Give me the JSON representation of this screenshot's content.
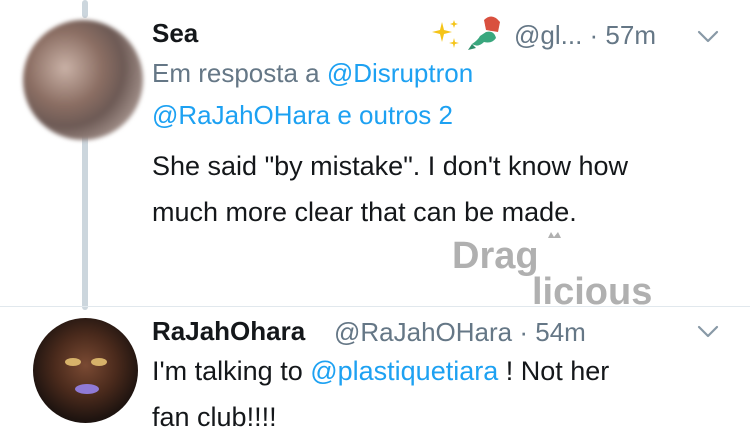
{
  "tweet1": {
    "name": "Sea",
    "emoji_icons": [
      "sparkles-icon",
      "mermaid-icon"
    ],
    "handle": "@gl...",
    "time_sep": " · ",
    "time": "57m",
    "reply_prefix": "Em resposta a ",
    "reply_to_1": "@Disruptron",
    "reply_to_2": "@RaJahOHara",
    "reply_suffix": " e outros 2",
    "text_line1": "She said \"by mistake\". I don't know how",
    "text_line2": "much more clear that can be made."
  },
  "tweet2": {
    "name": "RaJahOhara",
    "handle": "@RaJahOHara",
    "time_sep": " · ",
    "time": "54m",
    "text_prefix": "I'm talking to ",
    "mention": "@plastiquetiara",
    "text_suffix": " ! Not her",
    "text_line2": "fan club!!!!"
  },
  "watermark": {
    "text_top": "Drag",
    "text_bottom": "licious"
  },
  "colors": {
    "link": "#1da1f2",
    "muted": "#657786",
    "thread": "#ccd6dd",
    "watermark": "#b0b0b0"
  }
}
